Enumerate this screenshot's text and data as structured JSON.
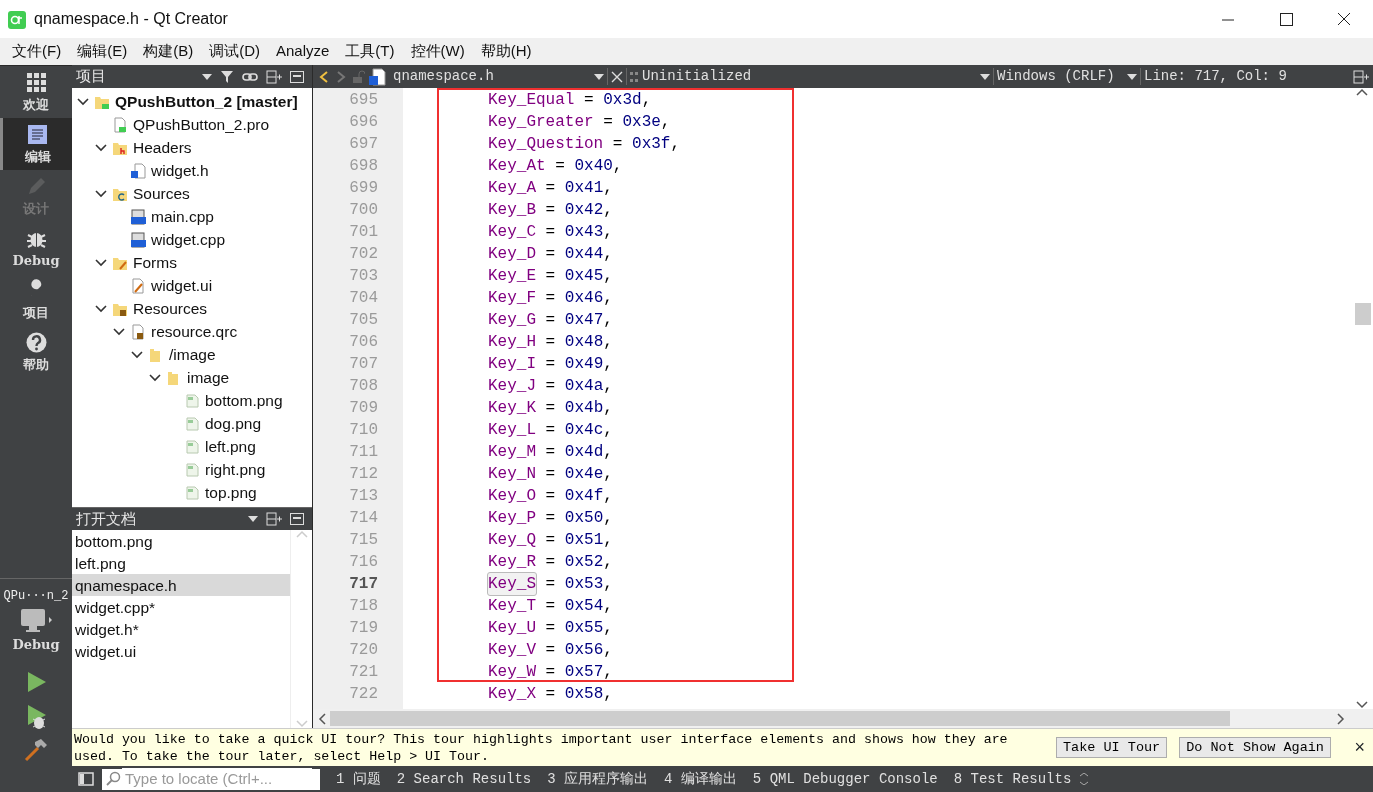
{
  "window": {
    "title": "qnamespace.h - Qt Creator"
  },
  "menu": [
    "文件(F)",
    "编辑(E)",
    "构建(B)",
    "调试(D)",
    "Analyze",
    "工具(T)",
    "控件(W)",
    "帮助(H)"
  ],
  "modes": [
    {
      "label": "欢迎",
      "kind": "welcome",
      "selected": false,
      "disabled": false
    },
    {
      "label": "编辑",
      "kind": "edit",
      "selected": true,
      "disabled": false
    },
    {
      "label": "设计",
      "kind": "design",
      "selected": false,
      "disabled": true
    },
    {
      "label": "Debug",
      "kind": "debug",
      "selected": false,
      "disabled": false
    },
    {
      "label": "项目",
      "kind": "projects",
      "selected": false,
      "disabled": false
    },
    {
      "label": "帮助",
      "kind": "help",
      "selected": false,
      "disabled": false
    }
  ],
  "target": {
    "project": "QPu···n_2",
    "config": "Debug"
  },
  "project_panel": {
    "title": "项目",
    "tree": [
      {
        "label": "QPushButton_2 [master]",
        "kind": "project",
        "expanded": true,
        "children": [
          {
            "label": "QPushButton_2.pro",
            "kind": "pro"
          },
          {
            "label": "Headers",
            "kind": "folder-h",
            "expanded": true,
            "children": [
              {
                "label": "widget.h",
                "kind": "header"
              }
            ]
          },
          {
            "label": "Sources",
            "kind": "folder-src",
            "expanded": true,
            "children": [
              {
                "label": "main.cpp",
                "kind": "cpp"
              },
              {
                "label": "widget.cpp",
                "kind": "cpp"
              }
            ]
          },
          {
            "label": "Forms",
            "kind": "folder-forms",
            "expanded": true,
            "children": [
              {
                "label": "widget.ui",
                "kind": "ui"
              }
            ]
          },
          {
            "label": "Resources",
            "kind": "folder-res",
            "expanded": true,
            "children": [
              {
                "label": "resource.qrc",
                "kind": "qrc",
                "expanded": true,
                "children": [
                  {
                    "label": "/image",
                    "kind": "folder",
                    "expanded": true,
                    "children": [
                      {
                        "label": "image",
                        "kind": "folder",
                        "expanded": true,
                        "children": [
                          {
                            "label": "bottom.png",
                            "kind": "png"
                          },
                          {
                            "label": "dog.png",
                            "kind": "png"
                          },
                          {
                            "label": "left.png",
                            "kind": "png"
                          },
                          {
                            "label": "right.png",
                            "kind": "png"
                          },
                          {
                            "label": "top.png",
                            "kind": "png"
                          }
                        ]
                      }
                    ]
                  }
                ]
              }
            ]
          }
        ]
      }
    ]
  },
  "open_documents": {
    "title": "打开文档",
    "items": [
      {
        "label": "bottom.png",
        "selected": false
      },
      {
        "label": "left.png",
        "selected": false
      },
      {
        "label": "qnamespace.h",
        "selected": true
      },
      {
        "label": "widget.cpp*",
        "selected": false
      },
      {
        "label": "widget.h*",
        "selected": false
      },
      {
        "label": "widget.ui",
        "selected": false
      }
    ]
  },
  "editor_toolbar": {
    "file": "qnamespace.h",
    "symbol": "Uninitialized",
    "line_endings": "Windows (CRLF)",
    "position": "Line: 717, Col: 9"
  },
  "code": [
    {
      "number": "695",
      "name": "Key_Equal",
      "operator": "=",
      "value": "0x3d",
      "punctuation": ",",
      "current": false
    },
    {
      "number": "696",
      "name": "Key_Greater",
      "operator": "=",
      "value": "0x3e",
      "punctuation": ",",
      "current": false
    },
    {
      "number": "697",
      "name": "Key_Question",
      "operator": "=",
      "value": "0x3f",
      "punctuation": ",",
      "current": false
    },
    {
      "number": "698",
      "name": "Key_At",
      "operator": "=",
      "value": "0x40",
      "punctuation": ",",
      "current": false
    },
    {
      "number": "699",
      "name": "Key_A",
      "operator": "=",
      "value": "0x41",
      "punctuation": ",",
      "current": false
    },
    {
      "number": "700",
      "name": "Key_B",
      "operator": "=",
      "value": "0x42",
      "punctuation": ",",
      "current": false
    },
    {
      "number": "701",
      "name": "Key_C",
      "operator": "=",
      "value": "0x43",
      "punctuation": ",",
      "current": false
    },
    {
      "number": "702",
      "name": "Key_D",
      "operator": "=",
      "value": "0x44",
      "punctuation": ",",
      "current": false
    },
    {
      "number": "703",
      "name": "Key_E",
      "operator": "=",
      "value": "0x45",
      "punctuation": ",",
      "current": false
    },
    {
      "number": "704",
      "name": "Key_F",
      "operator": "=",
      "value": "0x46",
      "punctuation": ",",
      "current": false
    },
    {
      "number": "705",
      "name": "Key_G",
      "operator": "=",
      "value": "0x47",
      "punctuation": ",",
      "current": false
    },
    {
      "number": "706",
      "name": "Key_H",
      "operator": "=",
      "value": "0x48",
      "punctuation": ",",
      "current": false
    },
    {
      "number": "707",
      "name": "Key_I",
      "operator": "=",
      "value": "0x49",
      "punctuation": ",",
      "current": false
    },
    {
      "number": "708",
      "name": "Key_J",
      "operator": "=",
      "value": "0x4a",
      "punctuation": ",",
      "current": false
    },
    {
      "number": "709",
      "name": "Key_K",
      "operator": "=",
      "value": "0x4b",
      "punctuation": ",",
      "current": false
    },
    {
      "number": "710",
      "name": "Key_L",
      "operator": "=",
      "value": "0x4c",
      "punctuation": ",",
      "current": false
    },
    {
      "number": "711",
      "name": "Key_M",
      "operator": "=",
      "value": "0x4d",
      "punctuation": ",",
      "current": false
    },
    {
      "number": "712",
      "name": "Key_N",
      "operator": "=",
      "value": "0x4e",
      "punctuation": ",",
      "current": false
    },
    {
      "number": "713",
      "name": "Key_O",
      "operator": "=",
      "value": "0x4f",
      "punctuation": ",",
      "current": false
    },
    {
      "number": "714",
      "name": "Key_P",
      "operator": "=",
      "value": "0x50",
      "punctuation": ",",
      "current": false
    },
    {
      "number": "715",
      "name": "Key_Q",
      "operator": "=",
      "value": "0x51",
      "punctuation": ",",
      "current": false
    },
    {
      "number": "716",
      "name": "Key_R",
      "operator": "=",
      "value": "0x52",
      "punctuation": ",",
      "current": false
    },
    {
      "number": "717",
      "name": "Key_S",
      "operator": "=",
      "value": "0x53",
      "punctuation": ",",
      "current": true
    },
    {
      "number": "718",
      "name": "Key_T",
      "operator": "=",
      "value": "0x54",
      "punctuation": ",",
      "current": false
    },
    {
      "number": "719",
      "name": "Key_U",
      "operator": "=",
      "value": "0x55",
      "punctuation": ",",
      "current": false
    },
    {
      "number": "720",
      "name": "Key_V",
      "operator": "=",
      "value": "0x56",
      "punctuation": ",",
      "current": false
    },
    {
      "number": "721",
      "name": "Key_W",
      "operator": "=",
      "value": "0x57",
      "punctuation": ",",
      "current": false
    },
    {
      "number": "722",
      "name": "Key_X",
      "operator": "=",
      "value": "0x58",
      "punctuation": ",",
      "current": false
    }
  ],
  "info_bar": {
    "message": "Would you like to take a quick UI tour? This tour highlights important user interface elements and shows how they are used. To take the tour later, select Help > UI Tour.",
    "buttons": [
      "Take UI Tour",
      "Do Not Show Again"
    ],
    "close": "×"
  },
  "status_bar": {
    "locator_placeholder": "Type to locate (Ctrl+...",
    "panes": [
      "1 问题",
      "2 Search Results",
      "3 应用程序输出",
      "4 编译输出",
      "5 QML Debugger Console",
      "8 Test Results"
    ]
  }
}
